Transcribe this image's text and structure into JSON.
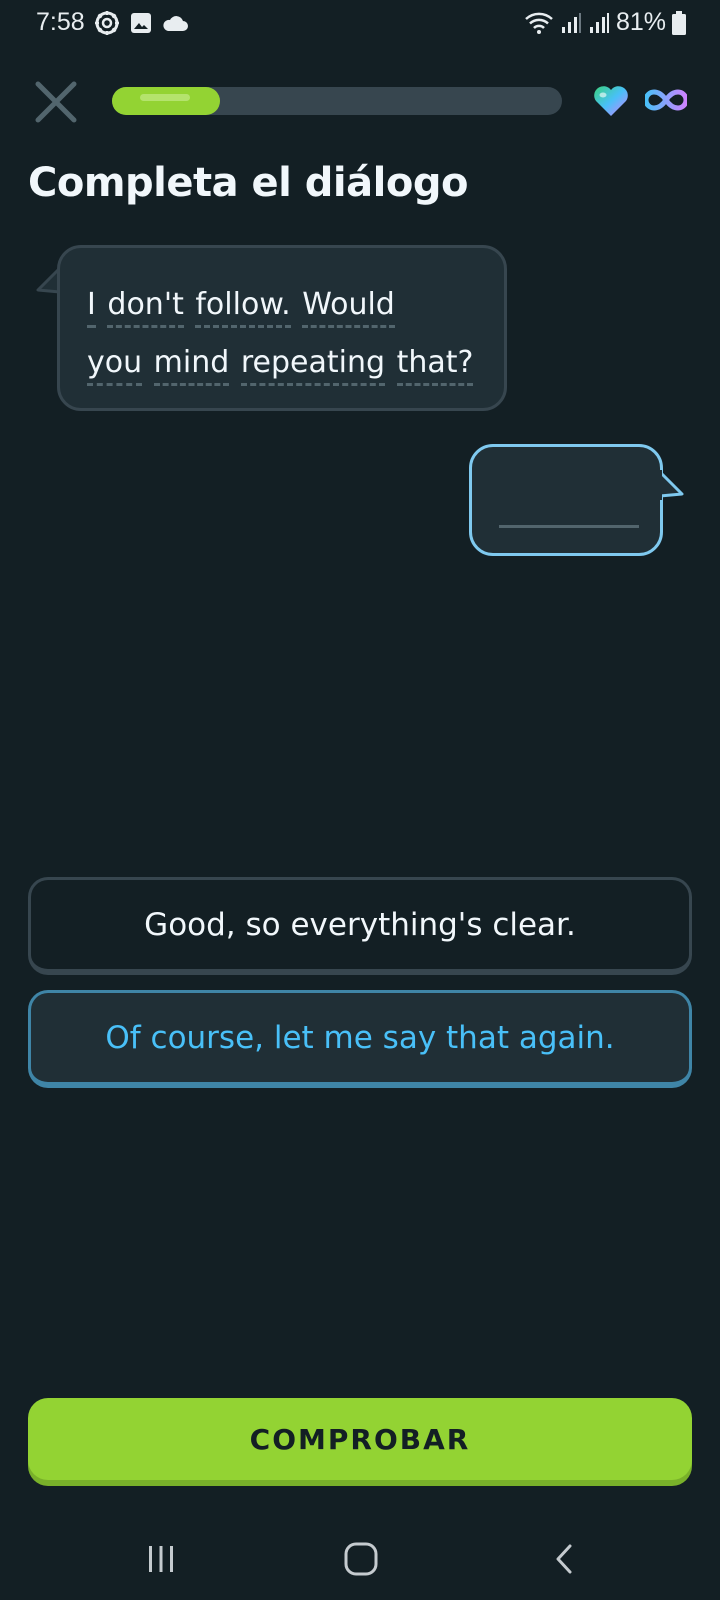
{
  "status_bar": {
    "time": "7:58",
    "battery": "81%",
    "icons_left": [
      "settings-gear-icon",
      "gallery-icon",
      "cloud-icon"
    ],
    "icons_right": [
      "wifi-icon",
      "signal-icon",
      "signal-icon",
      "battery-icon"
    ]
  },
  "header": {
    "close_icon": "close-icon",
    "progress_fraction": 0.24,
    "hearts_icon": "heart-icon",
    "hearts_value_icon": "infinity-icon"
  },
  "title": "Completa el diálogo",
  "prompt_bubble": {
    "line1_words": [
      "I",
      "don't",
      "follow.",
      "Would"
    ],
    "line2_words": [
      "you",
      "mind",
      "repeating",
      "that?"
    ]
  },
  "answer_bubble": {
    "value": ""
  },
  "options": [
    {
      "label": "Good, so everything's clear.",
      "selected": false
    },
    {
      "label": "Of course, let me say that again.",
      "selected": true
    }
  ],
  "check_button": {
    "label": "COMPROBAR"
  },
  "nav_bar": {
    "icons": [
      "recents-icon",
      "home-icon",
      "back-icon"
    ]
  },
  "colors": {
    "background": "#131f24",
    "accent_green": "#93d333",
    "accent_blue": "#49c0f8",
    "bubble_border": "#37464f"
  }
}
